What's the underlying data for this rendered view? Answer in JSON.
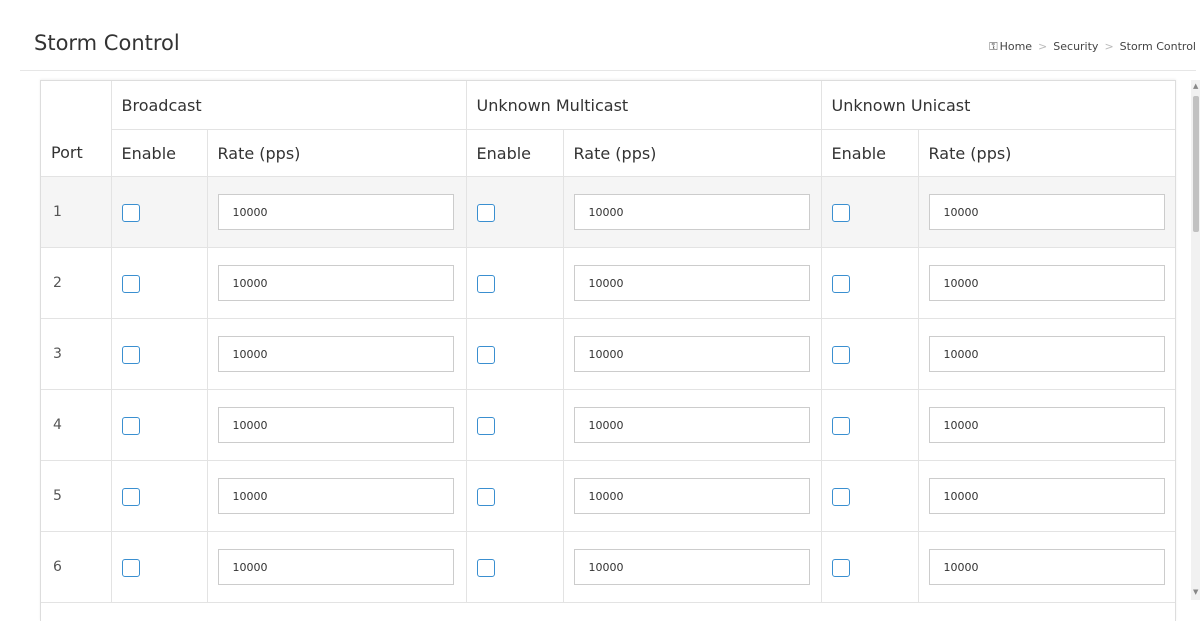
{
  "page": {
    "title": "Storm Control"
  },
  "breadcrumb": {
    "home": "Home",
    "section": "Security",
    "current": "Storm Control",
    "separator": ">"
  },
  "table": {
    "port_header": "Port",
    "groups": [
      "Broadcast",
      "Unknown Multicast",
      "Unknown Unicast"
    ],
    "enable_label": "Enable",
    "rate_label": "Rate (pps)",
    "rows": [
      {
        "port": "1",
        "broadcast": {
          "enabled": false,
          "rate": "10000"
        },
        "multicast": {
          "enabled": false,
          "rate": "10000"
        },
        "unicast": {
          "enabled": false,
          "rate": "10000"
        }
      },
      {
        "port": "2",
        "broadcast": {
          "enabled": false,
          "rate": "10000"
        },
        "multicast": {
          "enabled": false,
          "rate": "10000"
        },
        "unicast": {
          "enabled": false,
          "rate": "10000"
        }
      },
      {
        "port": "3",
        "broadcast": {
          "enabled": false,
          "rate": "10000"
        },
        "multicast": {
          "enabled": false,
          "rate": "10000"
        },
        "unicast": {
          "enabled": false,
          "rate": "10000"
        }
      },
      {
        "port": "4",
        "broadcast": {
          "enabled": false,
          "rate": "10000"
        },
        "multicast": {
          "enabled": false,
          "rate": "10000"
        },
        "unicast": {
          "enabled": false,
          "rate": "10000"
        }
      },
      {
        "port": "5",
        "broadcast": {
          "enabled": false,
          "rate": "10000"
        },
        "multicast": {
          "enabled": false,
          "rate": "10000"
        },
        "unicast": {
          "enabled": false,
          "rate": "10000"
        }
      },
      {
        "port": "6",
        "broadcast": {
          "enabled": false,
          "rate": "10000"
        },
        "multicast": {
          "enabled": false,
          "rate": "10000"
        },
        "unicast": {
          "enabled": false,
          "rate": "10000"
        }
      }
    ]
  },
  "icons": {
    "home": "home-icon",
    "scroll_up": "scroll-up-arrow-icon",
    "scroll_down": "scroll-down-arrow-icon"
  },
  "colors": {
    "checkbox_border": "#3a8fd0",
    "first_row_bg": "#f5f5f5"
  }
}
